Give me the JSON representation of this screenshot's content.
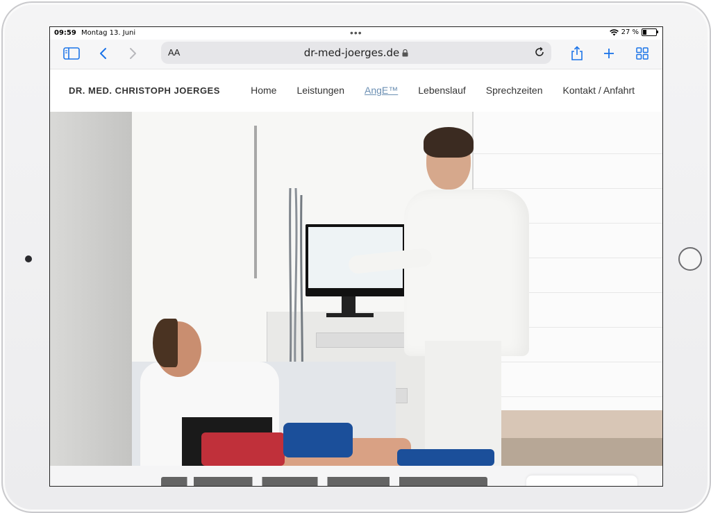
{
  "status_bar": {
    "time": "09:59",
    "date": "Montag 13. Juni",
    "multitask_dots": "•••",
    "battery_percent": "27 %"
  },
  "browser": {
    "text_size_label": "AA",
    "url": "dr-med-joerges.de",
    "icons": [
      "sidebar-icon",
      "back-icon",
      "forward-icon",
      "lock-icon",
      "reload-icon",
      "share-icon",
      "new-tab-icon",
      "tabs-grid-icon"
    ],
    "accent_color": "#1a73e8"
  },
  "site": {
    "brand": "DR. MED. CHRISTOPH JOERGES",
    "nav": [
      {
        "label": "Home"
      },
      {
        "label": "Leistungen"
      },
      {
        "label": "AngE™",
        "active": true
      },
      {
        "label": "Lebenslauf"
      },
      {
        "label": "Sprechzeiten"
      },
      {
        "label": "Kontakt / Anfahrt"
      }
    ],
    "active_color": "#6b8fb3"
  }
}
